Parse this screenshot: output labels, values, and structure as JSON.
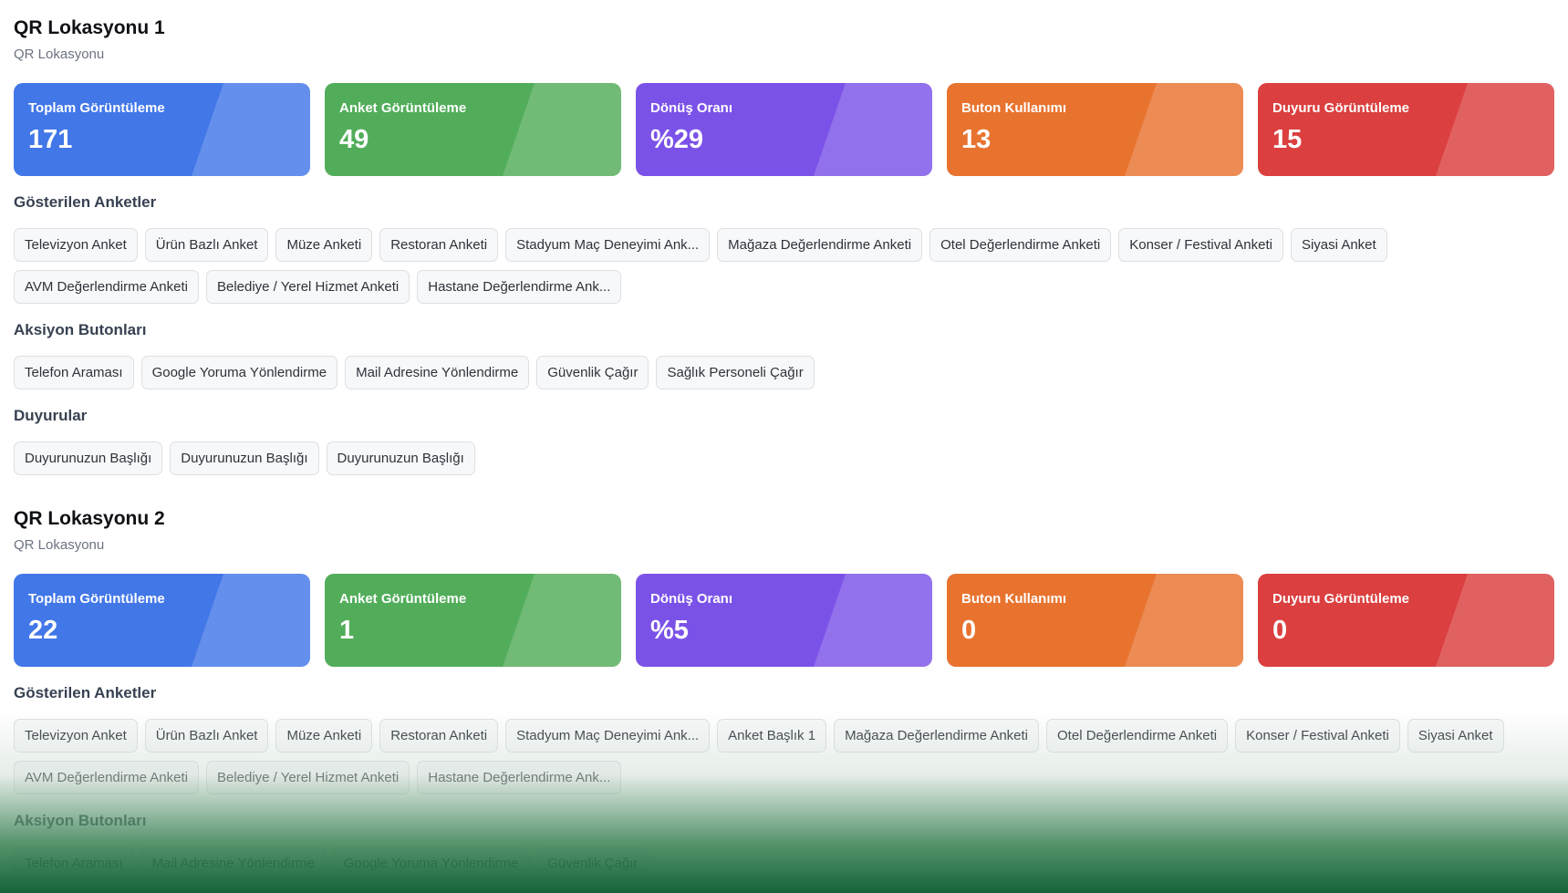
{
  "locations": [
    {
      "title": "QR Lokasyonu 1",
      "subtitle": "QR Lokasyonu",
      "stats": [
        {
          "label": "Toplam Görüntüleme",
          "value": "171",
          "color": "#4277e8"
        },
        {
          "label": "Anket Görüntüleme",
          "value": "49",
          "color": "#52ad5a"
        },
        {
          "label": "Dönüş Oranı",
          "value": "%29",
          "color": "#7b52e8"
        },
        {
          "label": "Buton Kullanımı",
          "value": "13",
          "color": "#e8732f"
        },
        {
          "label": "Duyuru Görüntüleme",
          "value": "15",
          "color": "#db3f3f"
        }
      ],
      "sections": [
        {
          "title": "Gösterilen Anketler",
          "items": [
            "Televizyon Anket",
            "Ürün Bazlı Anket",
            "Müze Anketi",
            "Restoran Anketi",
            "Stadyum Maç Deneyimi Ank...",
            "Mağaza Değerlendirme Anketi",
            "Otel Değerlendirme Anketi",
            "Konser / Festival Anketi",
            "Siyasi Anket",
            "AVM Değerlendirme Anketi",
            "Belediye / Yerel Hizmet Anketi",
            "Hastane Değerlendirme Ank..."
          ]
        },
        {
          "title": "Aksiyon Butonları",
          "items": [
            "Telefon Araması",
            "Google Yoruma Yönlendirme",
            "Mail Adresine Yönlendirme",
            "Güvenlik Çağır",
            "Sağlık Personeli Çağır"
          ]
        },
        {
          "title": "Duyurular",
          "items": [
            "Duyurunuzun Başlığı",
            "Duyurunuzun Başlığı",
            "Duyurunuzun Başlığı"
          ]
        }
      ]
    },
    {
      "title": "QR Lokasyonu 2",
      "subtitle": "QR Lokasyonu",
      "stats": [
        {
          "label": "Toplam Görüntüleme",
          "value": "22",
          "color": "#4277e8"
        },
        {
          "label": "Anket Görüntüleme",
          "value": "1",
          "color": "#52ad5a"
        },
        {
          "label": "Dönüş Oranı",
          "value": "%5",
          "color": "#7b52e8"
        },
        {
          "label": "Buton Kullanımı",
          "value": "0",
          "color": "#e8732f"
        },
        {
          "label": "Duyuru Görüntüleme",
          "value": "0",
          "color": "#db3f3f"
        }
      ],
      "sections": [
        {
          "title": "Gösterilen Anketler",
          "items": [
            "Televizyon Anket",
            "Ürün Bazlı Anket",
            "Müze Anketi",
            "Restoran Anketi",
            "Stadyum Maç Deneyimi Ank...",
            "Anket Başlık 1",
            "Mağaza Değerlendirme Anketi",
            "Otel Değerlendirme Anketi",
            "Konser / Festival Anketi",
            "Siyasi Anket",
            "AVM Değerlendirme Anketi",
            "Belediye / Yerel Hizmet Anketi",
            "Hastane Değerlendirme Ank..."
          ]
        },
        {
          "title": "Aksiyon Butonları",
          "items": [
            "Telefon Araması",
            "Mail Adresine Yönlendirme",
            "Google Yoruma Yönlendirme",
            "Güvenlik Çağır"
          ]
        }
      ]
    }
  ]
}
